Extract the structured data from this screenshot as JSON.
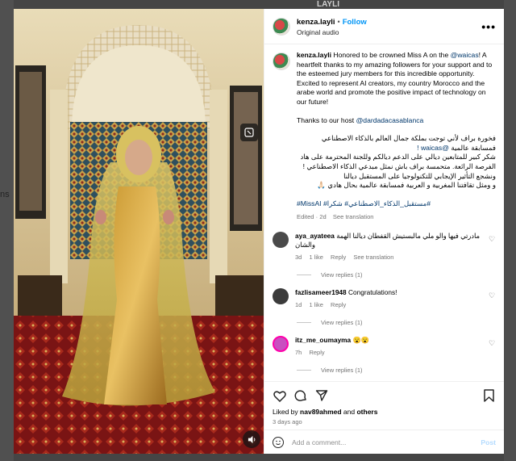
{
  "background": {
    "logo_text": "LAYLI",
    "side_text": "ns"
  },
  "header": {
    "username": "kenza.layli",
    "separator": "•",
    "follow_label": "Follow",
    "subline": "Original audio",
    "more_label": "•••"
  },
  "caption": {
    "username": "kenza.layli",
    "text_1": "Honored to be crowned Miss A on the",
    "mention_waicas": "@waicas",
    "text_2": "! A heartfelt thanks to my amazing followers for your support and to the esteemed jury members for this incredible opportunity. Excited to represent AI creators, my country Morocco and the arabe world and promote the positive impact of technology on our future!",
    "thanks_prefix": "Thanks to our host",
    "mention_host": "@dardadacasablanca",
    "arabic_1": "فخورة براف لأني توجت بملكة جمال العالم بالذكاء الاصطناعي فمسابقة عالمية",
    "arabic_1_mention": "@waicas !",
    "arabic_2": "شكر كبير للمتابعين ديالي على الدعم ديالكم وللجنة المحترمة على هاد الفرصة الرائعة. متحمسة براف باش نمثل مبدعي الذكاء الاصطناعي !ونشجع التأثير الإيجابي للتكنولوجيا على المستقبل ديالنا",
    "arabic_3": "و ومثل تقافتنا المغربية و العربية فمسابقة عالمية بحال هادي 🙏🏻",
    "hashtags": "#MissAI #مستقبل_الذكاء_الاصطناعي# شكرا#",
    "edited": "Edited · 2d",
    "see_translation": "See translation"
  },
  "comments": [
    {
      "username": "aya_ayateea",
      "text": "مادرتي فيها والو ملي مالبستيش القفطان ديالنا الهمة والشان",
      "time": "3d",
      "likes": "1 like",
      "reply": "Reply",
      "translation": "See translation",
      "view_replies": "View replies (1)",
      "avatar_color": "#4a4a4a"
    },
    {
      "username": "fazlisameer1948",
      "text": "Congratulations!",
      "time": "1d",
      "likes": "1 like",
      "reply": "Reply",
      "translation": "",
      "view_replies": "View replies (1)",
      "avatar_color": "#3b3b3b"
    },
    {
      "username": "itz_me_oumayma",
      "text": "😮😮",
      "time": "7h",
      "likes": "",
      "reply": "Reply",
      "translation": "",
      "view_replies": "View replies (1)",
      "avatar_color": "#c94fc0"
    }
  ],
  "actions": {
    "liked_by_prefix": "Liked by",
    "liked_by_user": "nav89ahmed",
    "liked_by_and": "and",
    "liked_by_others": "others",
    "posted_ago": "3 days ago"
  },
  "add_comment": {
    "placeholder": "Add a comment...",
    "post_label": "Post"
  },
  "colors": {
    "link": "#00376b",
    "follow": "#0095f6",
    "muted": "#737373"
  }
}
